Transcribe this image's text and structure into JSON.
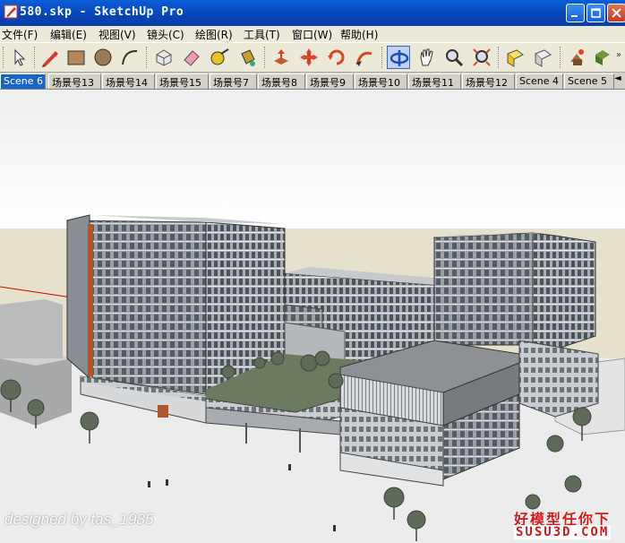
{
  "window": {
    "title": "580.skp - SketchUp Pro"
  },
  "menu": [
    "文件(F)",
    "编辑(E)",
    "视图(V)",
    "镜头(C)",
    "绘图(R)",
    "工具(T)",
    "窗口(W)",
    "帮助(H)"
  ],
  "toolbar": {
    "tools": [
      "select-tool",
      "pencil-line-tool",
      "rectangle-tool",
      "circle-tool",
      "arc-tool",
      "make-component-tool",
      "eraser-tool",
      "tape-measure-tool",
      "paint-bucket-tool",
      "push-pull-tool",
      "move-tool",
      "rotate-tool",
      "follow-me-tool",
      "orbit-tool",
      "pan-tool",
      "zoom-tool",
      "zoom-extents-tool",
      "previous-view-tool",
      "next-view-tool",
      "model-info-tool",
      "components-tool"
    ]
  },
  "scene_tabs": [
    "Scene 6",
    "场景号13",
    "场景号14",
    "场景号15",
    "场景号7",
    "场景号8",
    "场景号9",
    "场景号10",
    "场景号11",
    "场景号12",
    "Scene 4",
    "Scene 5"
  ],
  "active_tab": "Scene 6",
  "viewport": {
    "signature": "designed by tas_1985",
    "watermark_top": "好模型任你下",
    "watermark_bottom": "SUSU3D.COM"
  },
  "colors": {
    "sky": "#ffffff",
    "ground": "#e5e1cc",
    "plaza": "#ededed",
    "facade": "#8a8e94",
    "accent": "#b0562a"
  }
}
